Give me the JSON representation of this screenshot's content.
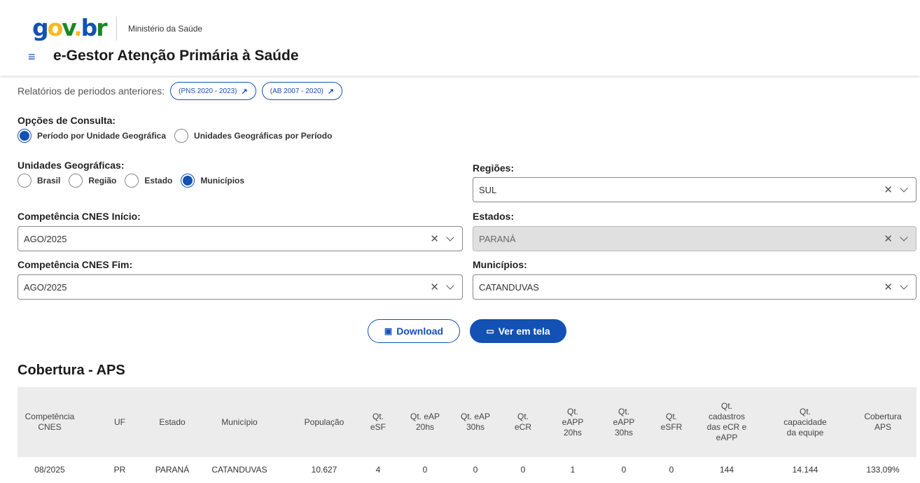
{
  "header": {
    "logo": {
      "g": "g",
      "o": "o",
      "v": "v",
      "dot": ".",
      "b": "b",
      "r": "r"
    },
    "ministry": "Ministério da Saúde",
    "app_title": "e-Gestor Atenção Primária à Saúde",
    "menu_icon": "≡"
  },
  "previous_reports": {
    "label": "Relatórios de periodos anteriores:",
    "links": [
      {
        "label": "(PNS 2020 - 2023)",
        "icon": "external-link-icon"
      },
      {
        "label": "(AB 2007 - 2020)",
        "icon": "external-link-icon"
      }
    ]
  },
  "consulta": {
    "label": "Opções de Consulta:",
    "options": [
      {
        "label": "Período por Unidade Geográfica",
        "checked": true
      },
      {
        "label": "Unidades Geográficas por Período",
        "checked": false
      }
    ]
  },
  "unidades": {
    "label": "Unidades Geográficas:",
    "options": [
      {
        "label": "Brasil",
        "checked": false
      },
      {
        "label": "Região",
        "checked": false
      },
      {
        "label": "Estado",
        "checked": false
      },
      {
        "label": "Municípios",
        "checked": true
      }
    ]
  },
  "regioes": {
    "label": "Regiões:",
    "value": "SUL"
  },
  "estados": {
    "label": "Estados:",
    "value": "PARANÁ",
    "disabled": true
  },
  "municipios": {
    "label": "Municípios:",
    "value": "CATANDUVAS"
  },
  "competencia_inicio": {
    "label": "Competência CNES Início:",
    "value": "AGO/2025"
  },
  "competencia_fim": {
    "label": "Competência CNES Fim:",
    "value": "AGO/2025"
  },
  "actions": {
    "download": "Download",
    "ver_em_tela": "Ver em tela"
  },
  "table": {
    "title": "Cobertura - APS",
    "columns": [
      "Competência CNES",
      "UF",
      "Estado",
      "Município",
      "População",
      "Qt. eSF",
      "Qt. eAP 20hs",
      "Qt. eAP 30hs",
      "Qt. eCR",
      "Qt. eAPP 20hs",
      "Qt. eAPP 30hs",
      "Qt. eSFR",
      "Qt. cadastros das eCR e eAPP",
      "Qt. capacidade da equipe",
      "Cobertura APS"
    ],
    "rows": [
      [
        "08/2025",
        "PR",
        "PARANÁ",
        "CATANDUVAS",
        "10.627",
        "4",
        "0",
        "0",
        "0",
        "1",
        "0",
        "0",
        "144",
        "14.144",
        "133,09%"
      ]
    ]
  },
  "colors": {
    "primary": "#1351b4",
    "header_bg": "#ececec"
  }
}
